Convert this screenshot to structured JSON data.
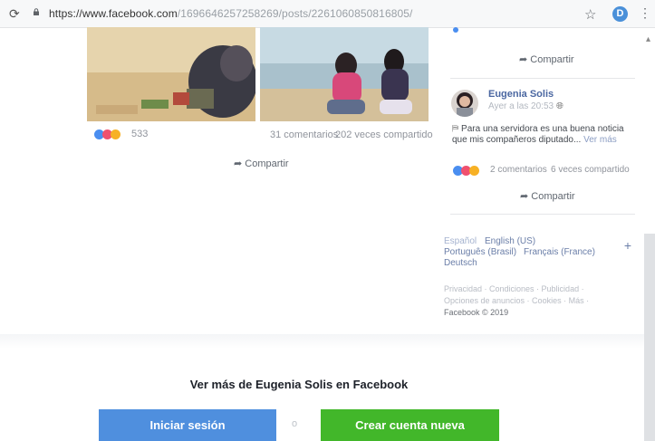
{
  "browser": {
    "url_host": "https://www.facebook.com",
    "url_path": "/1696646257258269/posts/2261060850816805/",
    "avatar_letter": "D",
    "accent": "#4a90d9"
  },
  "post": {
    "reaction_count": "533",
    "comments": "31 comentarios",
    "shares": "202 veces compartido",
    "share_label": "Compartir"
  },
  "sidebar": {
    "top_share_label": "Compartir",
    "author": "Eugenia Solis",
    "time": "Ayer a las 20:53",
    "text_prefix": "Para una servidora es una buena noticia que mis compañeros diputado...",
    "see_more": "Ver más",
    "comments": "2 comentarios",
    "shares": "6 veces compartido",
    "share_label": "Compartir"
  },
  "languages": {
    "current": "Español",
    "items": [
      "English (US)",
      "Português (Brasil)",
      "Français (France)",
      "Deutsch"
    ],
    "plus": "+"
  },
  "footer_links": {
    "line1": "Privacidad · Condiciones · Publicidad ·",
    "line2": "Opciones de anuncios · Cookies · Más ·",
    "copyright": "Facebook © 2019"
  },
  "cta": {
    "heading": "Ver más de Eugenia Solis en Facebook",
    "login": "Iniciar sesión",
    "or": "o",
    "create": "Crear cuenta nueva",
    "login_color": "#4f8fde",
    "create_color": "#42b72a"
  }
}
